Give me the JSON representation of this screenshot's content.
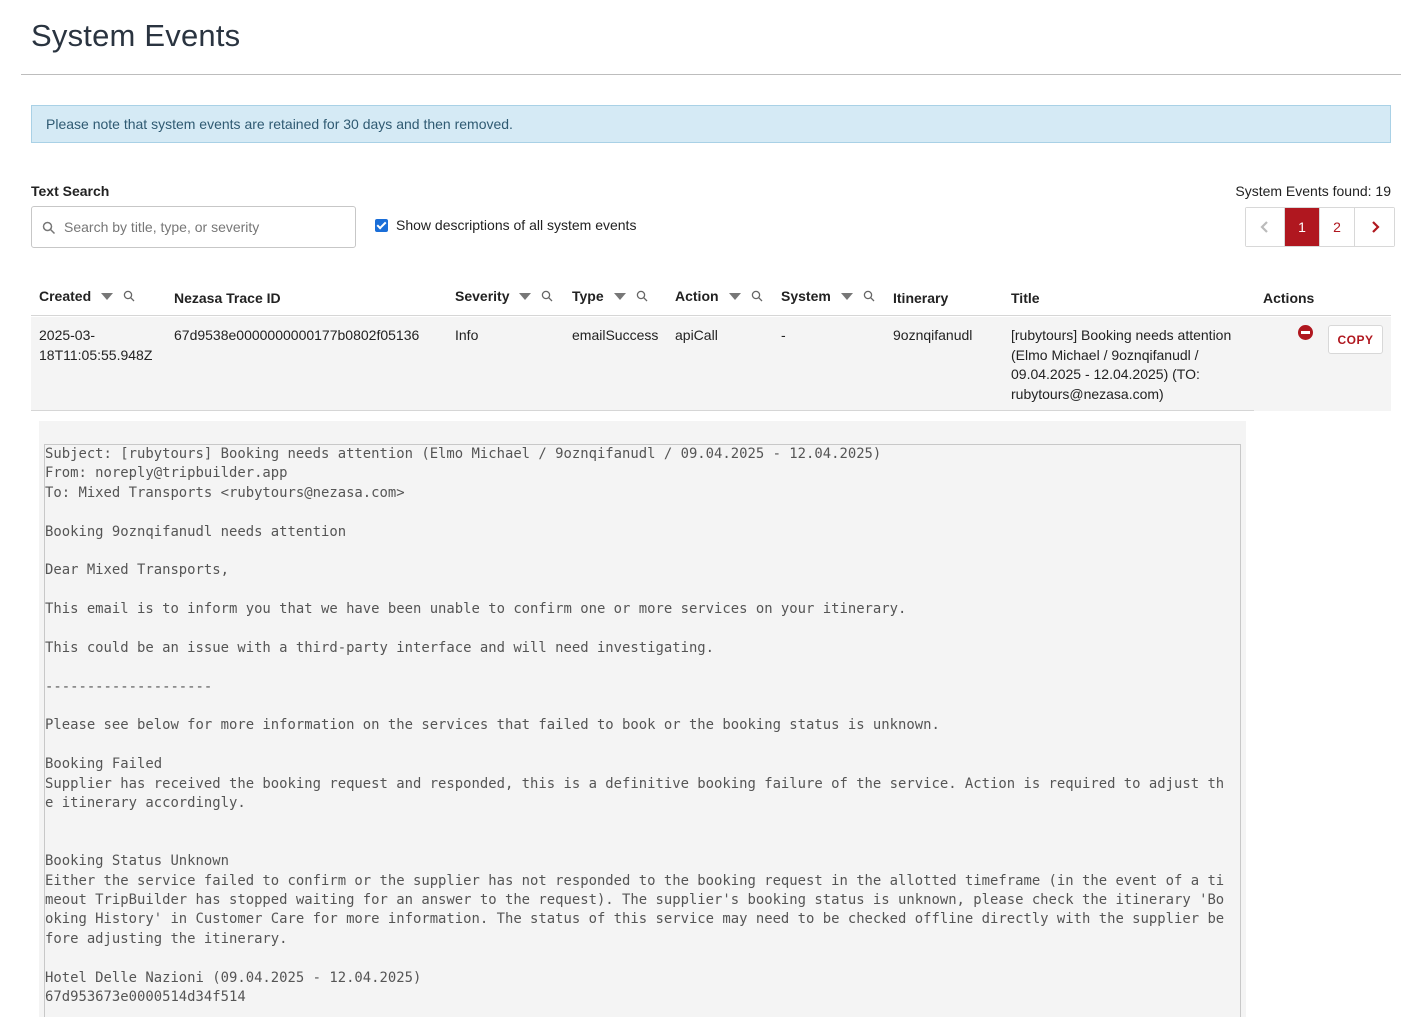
{
  "page": {
    "title": "System Events"
  },
  "notice": "Please note that system events are retained for 30 days and then removed.",
  "search": {
    "label": "Text Search",
    "placeholder": "Search by title, type, or severity",
    "value": ""
  },
  "show_descriptions": {
    "label": "Show descriptions of all system events",
    "checked": true
  },
  "results": {
    "found_label": "System Events found: 19"
  },
  "pagination": {
    "prev": "‹",
    "pages": [
      "1",
      "2"
    ],
    "active": "1",
    "next": "›"
  },
  "table": {
    "columns": {
      "created": "Created",
      "trace_id": "Nezasa Trace ID",
      "severity": "Severity",
      "type": "Type",
      "action": "Action",
      "system": "System",
      "itinerary": "Itinerary",
      "title": "Title",
      "actions": "Actions"
    },
    "rows": [
      {
        "created_line1": "2025-03-",
        "created_line2": "18T11:05:55.948Z",
        "trace_id": "67d9538e0000000000177b0802f05136",
        "severity": "Info",
        "type": "emailSuccess",
        "action": "apiCall",
        "system": "-",
        "itinerary": "9oznqifanudl",
        "title_lines": [
          "[rubytours] Booking needs attention",
          "(Elmo Michael / 9oznqifanudl /",
          "09.04.2025 - 12.04.2025) (TO:",
          "rubytours@nezasa.com)"
        ],
        "copy_label": "COPY"
      }
    ]
  },
  "description_lines": [
    "Subject: [rubytours] Booking needs attention (Elmo Michael / 9oznqifanudl / 09.04.2025 - 12.04.2025)",
    "From: noreply@tripbuilder.app",
    "To: Mixed Transports <rubytours@nezasa.com>",
    "",
    "Booking 9oznqifanudl needs attention",
    "",
    "Dear Mixed Transports,",
    "",
    "This email is to inform you that we have been unable to confirm one or more services on your itinerary.",
    "",
    "This could be an issue with a third-party interface and will need investigating.",
    "",
    "--------------------",
    "",
    "Please see below for more information on the services that failed to book or the booking status is unknown.",
    "",
    "Booking Failed",
    "Supplier has received the booking request and responded, this is a definitive booking failure of the service. Action is required to adjust th",
    "e itinerary accordingly.",
    "",
    "",
    "Booking Status Unknown",
    "Either the service failed to confirm or the supplier has not responded to the booking request in the allotted timeframe (in the event of a ti",
    "meout TripBuilder has stopped waiting for an answer to the request). The supplier's booking status is unknown, please check the itinerary 'Bo",
    "oking History' in Customer Care for more information. The status of this service may need to be checked offline directly with the supplier be",
    "fore adjusting the itinerary.",
    "",
    "Hotel Delle Nazioni (09.04.2025 - 12.04.2025)",
    "67d953673e0000514d34f514"
  ]
}
